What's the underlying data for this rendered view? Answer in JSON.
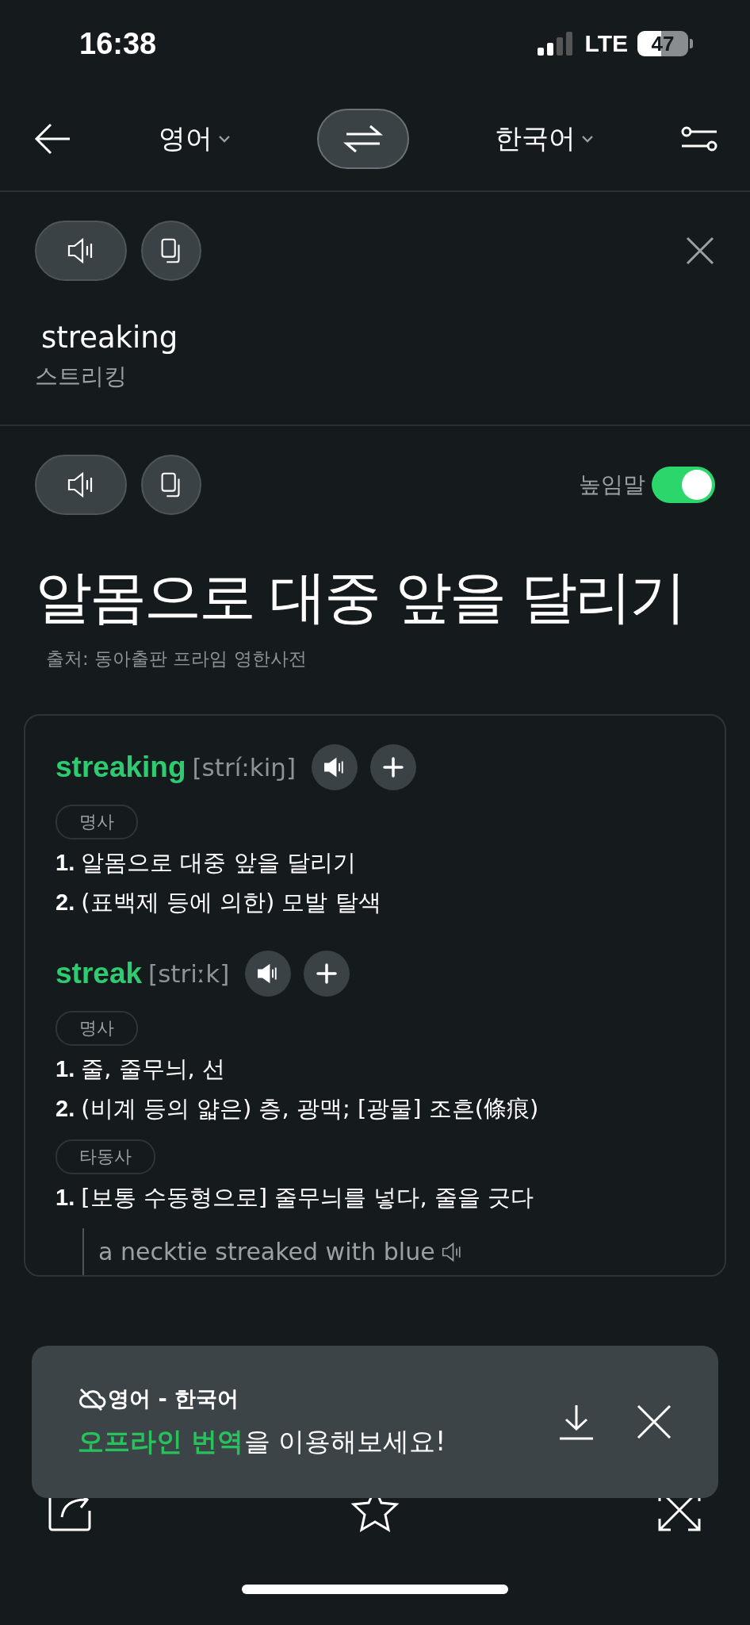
{
  "status_bar": {
    "time": "16:38",
    "network": "LTE",
    "battery": "47"
  },
  "nav": {
    "source_language": "영어",
    "target_language": "한국어"
  },
  "source": {
    "text": "streaking",
    "transliteration": "스트리킹"
  },
  "result": {
    "honorific_toggle": {
      "label": "높임말",
      "on": true
    },
    "translation": "알몸으로 대중 앞을 달리기",
    "credit": "출처: 동아출판 프라임 영한사전"
  },
  "dictionary": {
    "entries": [
      {
        "word": "streaking",
        "pronunciation": "[strí:kiŋ]",
        "senses": [
          {
            "part_of_speech": "명사",
            "definitions": [
              {
                "number": "1.",
                "text": "알몸으로 대중 앞을 달리기"
              },
              {
                "number": "2.",
                "text": "(표백제 등에 의한) 모발 탈색"
              }
            ]
          }
        ]
      },
      {
        "word": "streak",
        "pronunciation": "[striːk]",
        "senses": [
          {
            "part_of_speech": "명사",
            "definitions": [
              {
                "number": "1.",
                "text": "줄, 줄무늬, 선"
              },
              {
                "number": "2.",
                "text": "(비계 등의 얇은) 층, 광맥; [광물] 조흔(條痕)"
              }
            ]
          },
          {
            "part_of_speech": "타동사",
            "definitions": [
              {
                "number": "1.",
                "text": "[보통 수동형으로] 줄무늬를 넣다, 줄을 긋다",
                "examples": [
                  "a necktie streaked with blue"
                ]
              }
            ]
          }
        ]
      }
    ]
  },
  "toast": {
    "title": "영어 - 한국어",
    "message": "**오프라인 번역**을 이용해보세요!"
  }
}
